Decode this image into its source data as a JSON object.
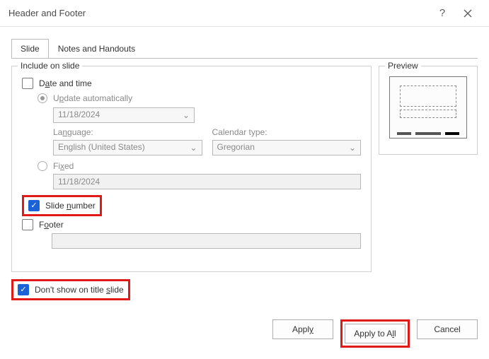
{
  "titlebar": {
    "title": "Header and Footer"
  },
  "tabs": {
    "slide": "Slide",
    "notes": "Notes and Handouts"
  },
  "include": {
    "legend": "Include on slide",
    "dateTimeLabel_pre": "D",
    "dateTimeLabel_ul": "a",
    "dateTimeLabel_post": "te and time",
    "updateAuto_pre": "U",
    "updateAuto_ul": "p",
    "updateAuto_post": "date automatically",
    "dateSelect": "11/18/2024",
    "langLabel_pre": "La",
    "langLabel_ul": "n",
    "langLabel_post": "guage:",
    "langSelect": "English (United States)",
    "calLabel": "Calendar type:",
    "calSelect": "Gregorian",
    "fixed_pre": "Fi",
    "fixed_ul": "x",
    "fixed_post": "ed",
    "fixedValue": "11/18/2024",
    "slideNum_pre": "Slide ",
    "slideNum_ul": "n",
    "slideNum_post": "umber",
    "footer_pre": "F",
    "footer_ul": "o",
    "footer_post": "oter"
  },
  "dontShow_pre": "Don't show on title ",
  "dontShow_ul": "s",
  "dontShow_post": "lide",
  "preview": {
    "legend": "Preview"
  },
  "buttons": {
    "apply_pre": "Appl",
    "apply_ul": "y",
    "apply_post": "",
    "applyAll_pre": "Apply to A",
    "applyAll_ul": "l",
    "applyAll_post": "l",
    "cancel": "Cancel"
  },
  "dropdownCaret": "⌄"
}
